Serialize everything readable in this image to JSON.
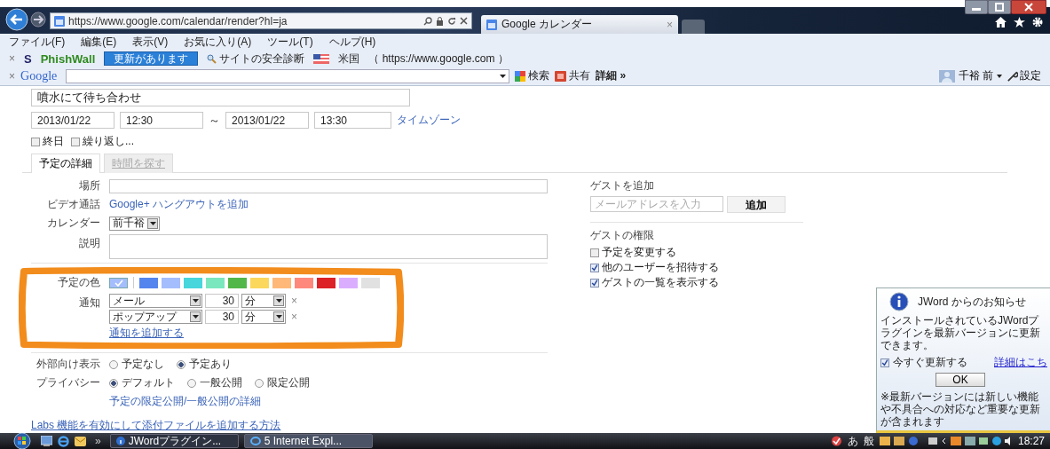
{
  "browser": {
    "address": "https://www.google.com/calendar/render?hl=ja",
    "tab_title": "Google カレンダー",
    "tab_close": "×"
  },
  "menu": [
    "ファイル(F)",
    "編集(E)",
    "表示(V)",
    "お気に入り(A)",
    "ツール(T)",
    "ヘルプ(H)"
  ],
  "phishwall": {
    "close": "×",
    "s_label": "S",
    "name": "PhishWall",
    "update_badge": "更新があります",
    "site_check": "サイトの安全診断",
    "country": "米国",
    "url": "（ https://www.google.com ）"
  },
  "google_toolbar": {
    "close": "×",
    "logo": "Google",
    "search": "検索",
    "share": "共有",
    "more": "詳細 »",
    "user": "千裕 前",
    "settings": "設定"
  },
  "event": {
    "title": "噴水にて待ち合わせ",
    "start_date": "2013/01/22",
    "start_time": "12:30",
    "separator": "～",
    "end_date": "2013/01/22",
    "end_time": "13:30",
    "timezone_link": "タイムゾーン",
    "options": [
      {
        "label": "終日",
        "checked": false
      },
      {
        "label": "繰り返し...",
        "checked": false
      }
    ]
  },
  "tabs": [
    {
      "label": "予定の詳細",
      "selected": true
    },
    {
      "label": "時間を探す",
      "selected": false
    }
  ],
  "details": {
    "location_label": "場所",
    "video_label": "ビデオ通話",
    "video_link": "Google+ ハングアウトを追加",
    "calendar_label": "カレンダー",
    "calendar_value": "前千裕",
    "description_label": "説明",
    "color_label": "予定の色",
    "colors": [
      {
        "color": "#a4bdfc",
        "selected": true
      },
      {
        "color": "#5484ed",
        "selected": false
      },
      {
        "color": "#a4bdfc",
        "selected": false
      },
      {
        "color": "#46d6db",
        "selected": false
      },
      {
        "color": "#7ae7bf",
        "selected": false
      },
      {
        "color": "#51b749",
        "selected": false
      },
      {
        "color": "#fbd75b",
        "selected": false
      },
      {
        "color": "#ffb878",
        "selected": false
      },
      {
        "color": "#ff887c",
        "selected": false
      },
      {
        "color": "#dc2127",
        "selected": false
      },
      {
        "color": "#dbadff",
        "selected": false
      },
      {
        "color": "#e1e1e1",
        "selected": false
      }
    ],
    "reminder_label": "通知",
    "reminders": [
      {
        "method": "メール",
        "amount": "30",
        "unit": "分",
        "remove": "×"
      },
      {
        "method": "ポップアップ",
        "amount": "30",
        "unit": "分",
        "remove": "×"
      }
    ],
    "add_reminder": "通知を追加する",
    "visibility_label": "外部向け表示",
    "visibility": [
      {
        "label": "予定なし",
        "selected": false
      },
      {
        "label": "予定あり",
        "selected": true
      }
    ],
    "privacy_label": "プライバシー",
    "privacy": [
      {
        "label": "デフォルト",
        "selected": true
      },
      {
        "label": "一般公開",
        "selected": false
      },
      {
        "label": "限定公開",
        "selected": false
      }
    ],
    "privacy_link": "予定の限定公開/一般公開の詳細"
  },
  "guests": {
    "heading": "ゲストを追加",
    "placeholder": "メールアドレスを入力",
    "add_button": "追加",
    "permissions_heading": "ゲストの権限",
    "permissions": [
      {
        "label": "予定を変更する",
        "checked": false
      },
      {
        "label": "他のユーザーを招待する",
        "checked": true
      },
      {
        "label": "ゲストの一覧を表示する",
        "checked": true
      }
    ]
  },
  "labs_link": "Labs 機能を有効にして添付ファイルを追加する方法",
  "taskbar": {
    "overflow": "»",
    "items": [
      {
        "label": "JWordプラグイン...",
        "selected": false
      },
      {
        "label": "5 Internet Expl...",
        "selected": true
      }
    ],
    "ime": [
      "あ",
      "般"
    ],
    "clock": "18:27"
  },
  "notification": {
    "title": "JWord からのお知らせ",
    "message": "インストールされているJWordプラグインを最新バージョンに更新できます。",
    "checkbox": {
      "label": "今すぐ更新する",
      "checked": true
    },
    "details_link": "詳細はこち",
    "ok": "OK",
    "note": "※最新バージョンには新しい機能や不具合への対応など重要な更新が含まれます"
  }
}
